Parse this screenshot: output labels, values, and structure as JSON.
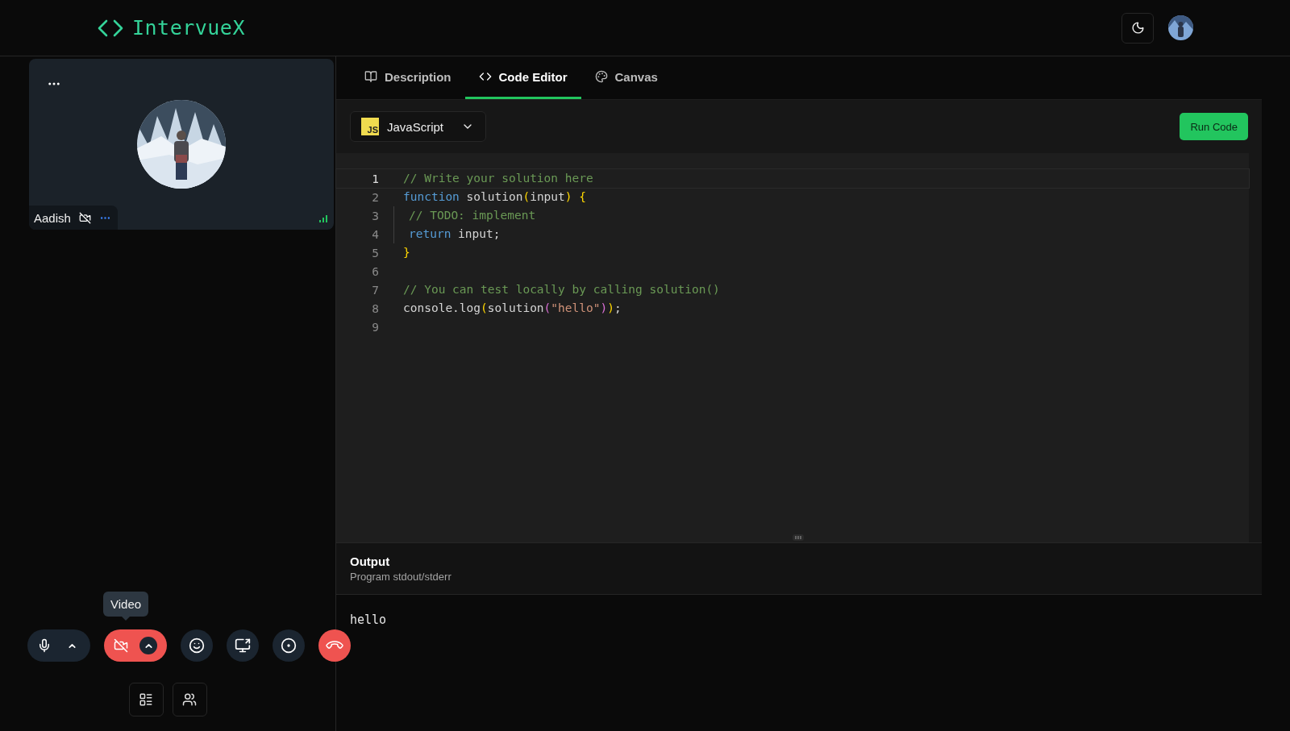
{
  "header": {
    "logo": "IntervueX"
  },
  "participant": {
    "name": "Aadish",
    "camera_on": false
  },
  "tooltip": "Video",
  "controls": [
    {
      "kind": "mic",
      "on": true
    },
    {
      "kind": "camera",
      "on": false
    },
    {
      "kind": "reaction"
    },
    {
      "kind": "share"
    },
    {
      "kind": "record"
    },
    {
      "kind": "hangup"
    }
  ],
  "tabs": [
    {
      "label": "Description",
      "selected": false
    },
    {
      "label": "Code Editor",
      "selected": true
    },
    {
      "label": "Canvas",
      "selected": false
    }
  ],
  "language": {
    "badge": "JS",
    "label": "JavaScript"
  },
  "run_button": "Run Code",
  "editor": {
    "lines": [
      {
        "number": "1",
        "tokens": [
          {
            "kind": "comment",
            "text": "// Write your solution here"
          }
        ]
      },
      {
        "number": "2",
        "tokens": [
          {
            "kind": "keyword",
            "text": "function"
          },
          {
            "kind": "plain",
            "text": " solution"
          },
          {
            "kind": "paren",
            "text": "("
          },
          {
            "kind": "plain",
            "text": "input"
          },
          {
            "kind": "paren",
            "text": ")"
          },
          {
            "kind": "brace",
            "text": " {"
          }
        ]
      },
      {
        "number": "3",
        "indent": true,
        "tokens": [
          {
            "kind": "comment",
            "text": "// TODO: implement"
          }
        ]
      },
      {
        "number": "4",
        "indent": true,
        "tokens": [
          {
            "kind": "keyword",
            "text": "return"
          },
          {
            "kind": "plain",
            "text": " input;"
          }
        ]
      },
      {
        "number": "5",
        "tokens": [
          {
            "kind": "brace",
            "text": "}"
          }
        ]
      },
      {
        "number": "6"
      },
      {
        "number": "7",
        "tokens": [
          {
            "kind": "comment",
            "text": "// You can test locally by calling solution()"
          }
        ]
      },
      {
        "number": "8",
        "tokens": [
          {
            "kind": "plain",
            "text": "console.log"
          },
          {
            "kind": "brace",
            "text": "("
          },
          {
            "kind": "plain",
            "text": "solution"
          },
          {
            "kind": "paren2",
            "text": "("
          },
          {
            "kind": "string",
            "text": "\"hello\""
          },
          {
            "kind": "paren2",
            "text": ")"
          },
          {
            "kind": "brace",
            "text": ")"
          },
          {
            "kind": "plain",
            "text": ";"
          }
        ]
      },
      {
        "number": "9"
      }
    ]
  },
  "output": {
    "title": "Output",
    "subtitle": "Program stdout/stderr",
    "text": "hello"
  }
}
